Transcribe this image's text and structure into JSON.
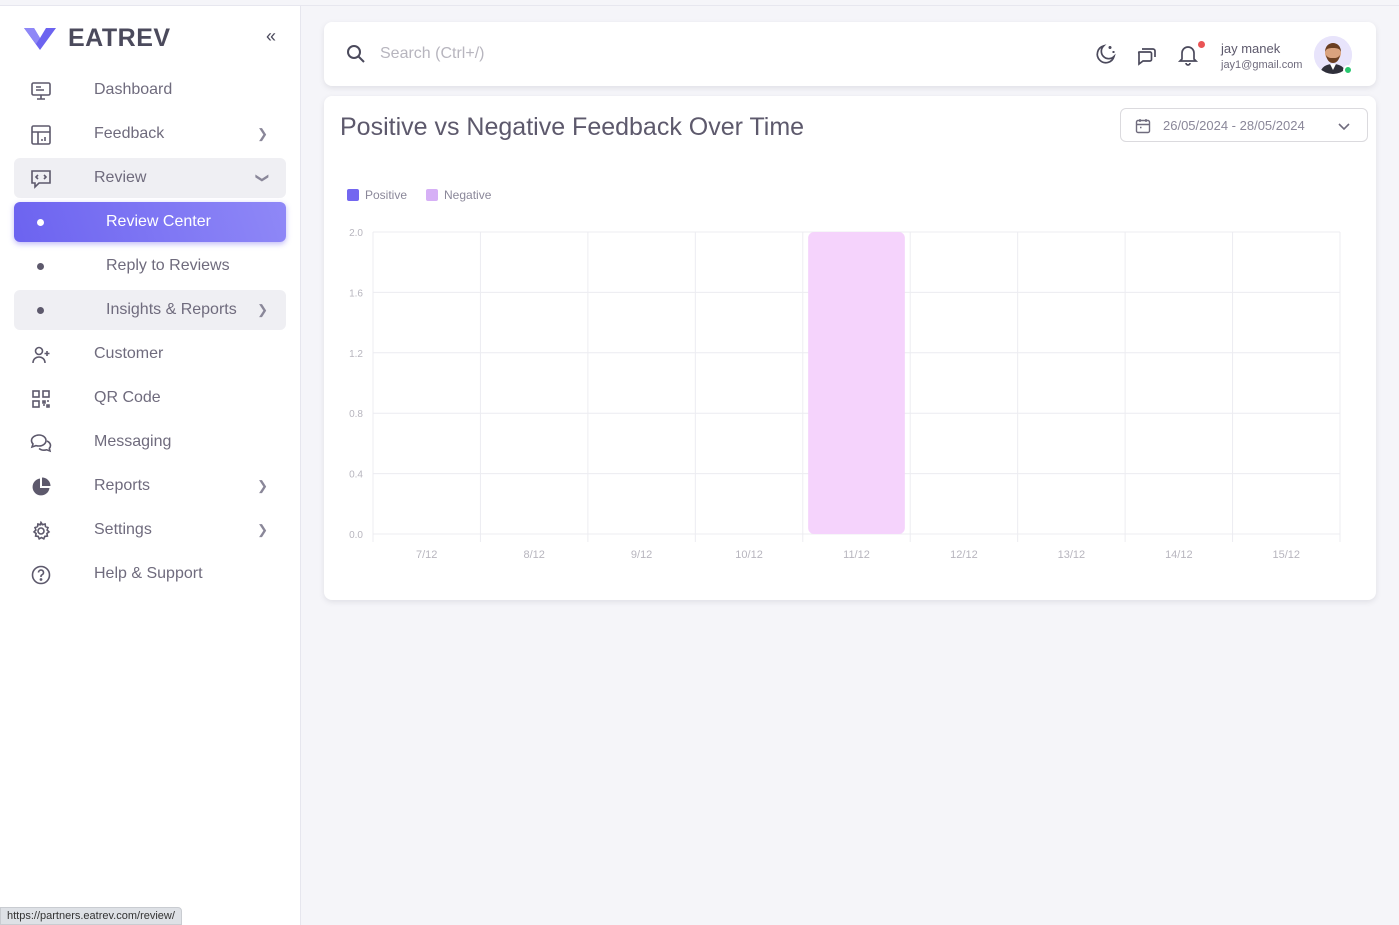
{
  "app": {
    "brand": "EATREV"
  },
  "sidebar": {
    "items": [
      {
        "label": "Dashboard"
      },
      {
        "label": "Feedback"
      },
      {
        "label": "Review"
      },
      {
        "label": "Review Center"
      },
      {
        "label": "Reply to Reviews"
      },
      {
        "label": "Insights & Reports"
      },
      {
        "label": "Customer"
      },
      {
        "label": "QR Code"
      },
      {
        "label": "Messaging"
      },
      {
        "label": "Reports"
      },
      {
        "label": "Settings"
      },
      {
        "label": "Help & Support"
      }
    ]
  },
  "header": {
    "search_placeholder": "Search (Ctrl+/)",
    "user_name": "jay manek",
    "user_email": "jay1@gmail.com"
  },
  "card": {
    "title": "Positive vs Negative Feedback Over Time",
    "date_range": "26/05/2024 - 28/05/2024"
  },
  "colors": {
    "accent": "#7367f0",
    "positive": "#7367f0",
    "negative": "#d6b0f6",
    "negative_bar": "#f5d3fc"
  },
  "chart_data": {
    "type": "bar",
    "categories": [
      "7/12",
      "8/12",
      "9/12",
      "10/12",
      "11/12",
      "12/12",
      "13/12",
      "14/12",
      "15/12"
    ],
    "series": [
      {
        "name": "Positive",
        "values": [
          0,
          0,
          0,
          0,
          0,
          0,
          0,
          0,
          0
        ]
      },
      {
        "name": "Negative",
        "values": [
          0,
          0,
          0,
          0,
          2,
          0,
          0,
          0,
          0
        ]
      }
    ],
    "yticks": [
      "0.0",
      "0.4",
      "0.8",
      "1.2",
      "1.6",
      "2.0"
    ],
    "ylim": [
      0,
      2
    ],
    "grid": true,
    "legend": "top-left"
  },
  "statusbar": {
    "url": "https://partners.eatrev.com/review/"
  }
}
